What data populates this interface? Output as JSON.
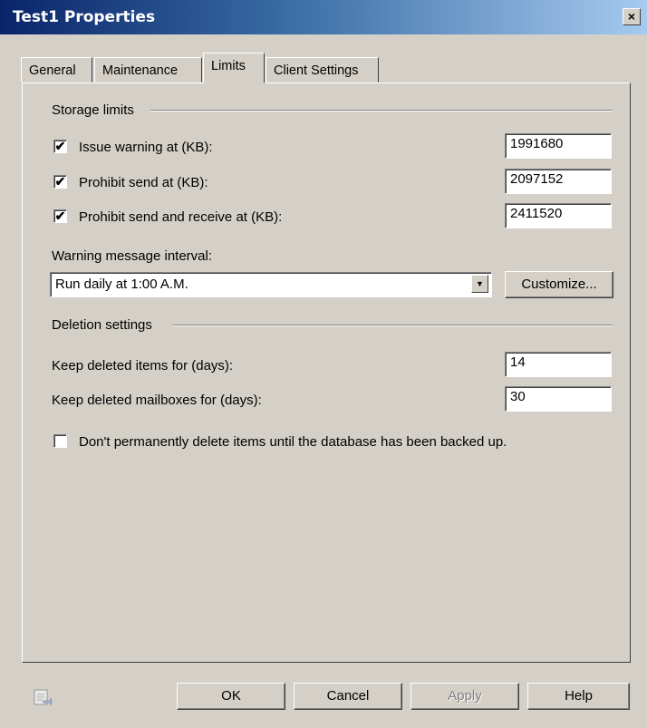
{
  "window": {
    "title": "Test1 Properties",
    "close_glyph": "×"
  },
  "tabs": [
    {
      "label": "General",
      "active": false
    },
    {
      "label": "Maintenance",
      "active": false
    },
    {
      "label": "Limits",
      "active": true
    },
    {
      "label": "Client Settings",
      "active": false
    }
  ],
  "storage": {
    "heading": "Storage limits",
    "rows": [
      {
        "label": "Issue warning at (KB):",
        "checked": true,
        "value": "1991680"
      },
      {
        "label": "Prohibit send at (KB):",
        "checked": true,
        "value": "2097152"
      },
      {
        "label": "Prohibit send and receive at (KB):",
        "checked": true,
        "value": "2411520"
      }
    ],
    "check_glyph": "✔",
    "warning_interval_label": "Warning message interval:",
    "warning_interval_value": "Run daily at 1:00 A.M.",
    "customize_label": "Customize..."
  },
  "deletion": {
    "heading": "Deletion settings",
    "items_label": "Keep deleted items for (days):",
    "items_value": "14",
    "mailboxes_label": "Keep deleted mailboxes for (days):",
    "mailboxes_value": "30",
    "backup_label": "Don't permanently delete items until the database has been backed up.",
    "backup_checked": false
  },
  "buttons": {
    "ok": "OK",
    "cancel": "Cancel",
    "apply": "Apply",
    "help": "Help"
  },
  "icons": {
    "close": "close-icon",
    "dropdown": "chevron-down-icon",
    "corner": "properties-page-icon"
  }
}
